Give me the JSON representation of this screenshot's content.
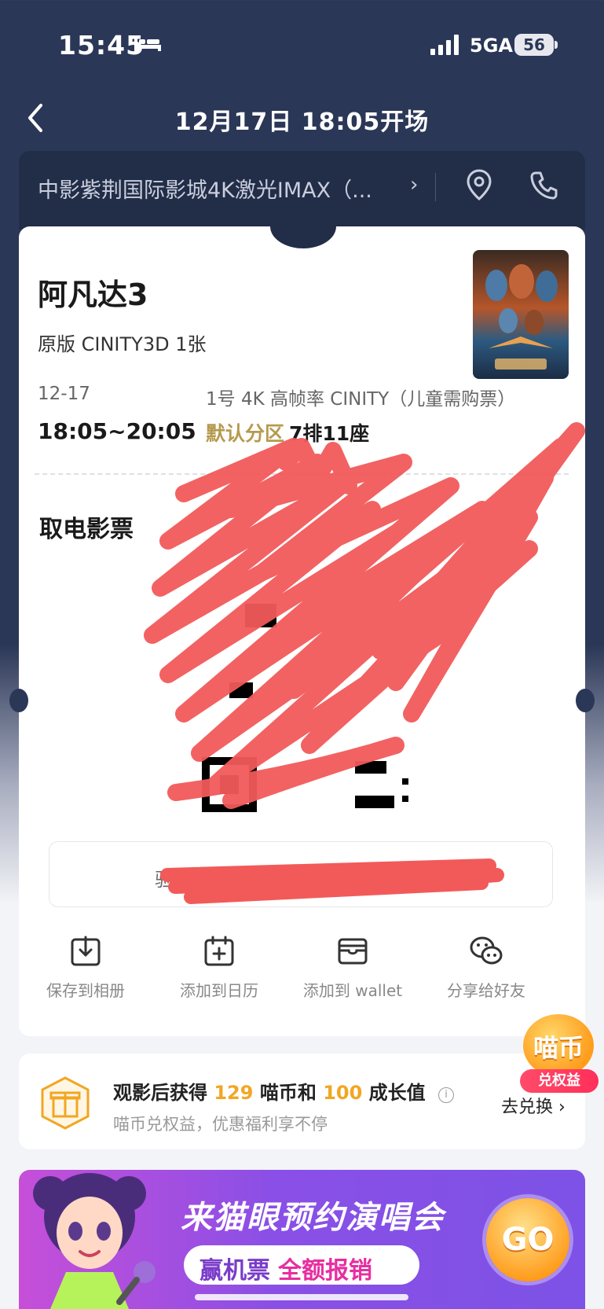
{
  "status_bar": {
    "time": "15:45",
    "network": "5GA",
    "battery": "56"
  },
  "nav": {
    "title": "12月17日 18:05开场"
  },
  "cinema": {
    "name": "中影紫荆国际影城4K激光IMAX（...",
    "chevron": "›"
  },
  "ticket": {
    "movie_title": "阿凡达3",
    "format": "原版 CINITY3D 1张",
    "date": "12-17",
    "time_range": "18:05~20:05",
    "hall": "1号 4K 高帧率 CINITY（儿童需购票）",
    "seat_zone": "默认分区",
    "seat": "7排11座",
    "pickup_title": "取电影票",
    "verify_prefix": "验"
  },
  "actions": [
    {
      "label": "保存到相册",
      "icon": "download-album-icon"
    },
    {
      "label": "添加到日历",
      "icon": "calendar-add-icon"
    },
    {
      "label": "添加到 wallet",
      "icon": "wallet-icon"
    },
    {
      "label": "分享给好友",
      "icon": "wechat-share-icon"
    }
  ],
  "coin_badge": {
    "title": "喵币",
    "tag": "兑权益"
  },
  "reward": {
    "text_before": "观影后获得",
    "coins": "129",
    "text_mid": "喵币和",
    "growth": "100",
    "text_after": "成长值",
    "info": "i",
    "subtitle": "喵币兑权益，优惠福利享不停",
    "redeem": "去兑换 ›"
  },
  "banner": {
    "title": "来猫眼预约演唱会",
    "sub1": "赢机票",
    "sub2": "全额报销",
    "go": "GO"
  },
  "colors": {
    "header_bg": "#2b3757",
    "seat_zone": "#b59a4e",
    "reward_accent": "#f2a623",
    "banner_purple": "#8a4fe6"
  }
}
